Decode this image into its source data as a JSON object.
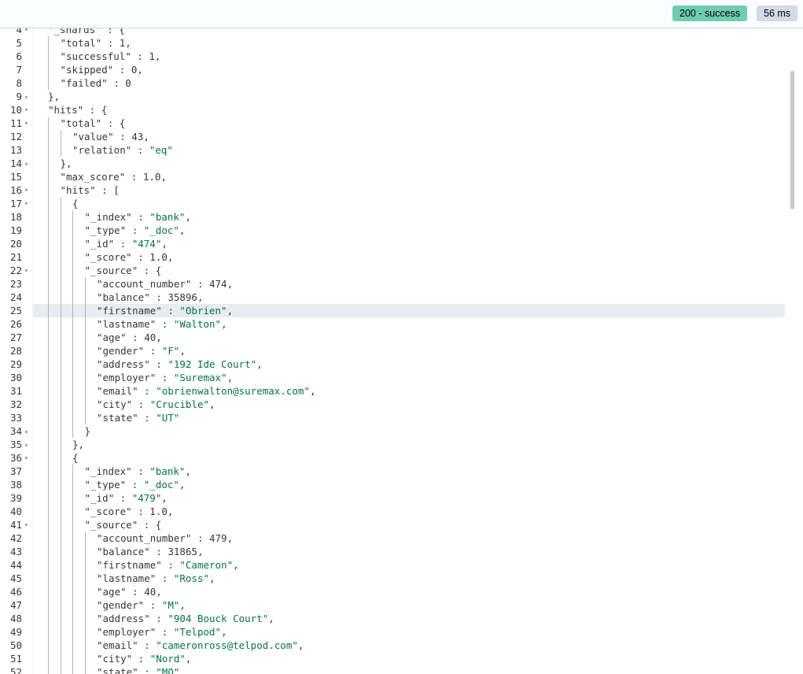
{
  "response": {
    "status_badge": "200 - success",
    "time_badge": "56 ms",
    "colors": {
      "success": "#6dccb1",
      "neutral": "#d3dae6",
      "string": "#00783e"
    }
  },
  "editor": {
    "active_line": 25,
    "lines": [
      {
        "n": "4",
        "fold": "down",
        "indent": 1,
        "text": "\"_shards\" : {"
      },
      {
        "n": "5",
        "fold": "",
        "indent": 2,
        "text": "\"total\" : 1,"
      },
      {
        "n": "6",
        "fold": "",
        "indent": 2,
        "text": "\"successful\" : 1,"
      },
      {
        "n": "7",
        "fold": "",
        "indent": 2,
        "text": "\"skipped\" : 0,"
      },
      {
        "n": "8",
        "fold": "",
        "indent": 2,
        "text": "\"failed\" : 0"
      },
      {
        "n": "9",
        "fold": "up",
        "indent": 1,
        "text": "},"
      },
      {
        "n": "10",
        "fold": "down",
        "indent": 1,
        "text": "\"hits\" : {"
      },
      {
        "n": "11",
        "fold": "down",
        "indent": 2,
        "text": "\"total\" : {"
      },
      {
        "n": "12",
        "fold": "",
        "indent": 3,
        "text": "\"value\" : 43,"
      },
      {
        "n": "13",
        "fold": "",
        "indent": 3,
        "text": "\"relation\" : \"eq\""
      },
      {
        "n": "14",
        "fold": "up",
        "indent": 2,
        "text": "},"
      },
      {
        "n": "15",
        "fold": "",
        "indent": 2,
        "text": "\"max_score\" : 1.0,"
      },
      {
        "n": "16",
        "fold": "down",
        "indent": 2,
        "text": "\"hits\" : ["
      },
      {
        "n": "17",
        "fold": "down",
        "indent": 3,
        "text": "{"
      },
      {
        "n": "18",
        "fold": "",
        "indent": 4,
        "text": "\"_index\" : \"bank\","
      },
      {
        "n": "19",
        "fold": "",
        "indent": 4,
        "text": "\"_type\" : \"_doc\","
      },
      {
        "n": "20",
        "fold": "",
        "indent": 4,
        "text": "\"_id\" : \"474\","
      },
      {
        "n": "21",
        "fold": "",
        "indent": 4,
        "text": "\"_score\" : 1.0,"
      },
      {
        "n": "22",
        "fold": "down",
        "indent": 4,
        "text": "\"_source\" : {"
      },
      {
        "n": "23",
        "fold": "",
        "indent": 5,
        "text": "\"account_number\" : 474,"
      },
      {
        "n": "24",
        "fold": "",
        "indent": 5,
        "text": "\"balance\" : 35896,"
      },
      {
        "n": "25",
        "fold": "",
        "indent": 5,
        "text": "\"firstname\" : \"Obrien\","
      },
      {
        "n": "26",
        "fold": "",
        "indent": 5,
        "text": "\"lastname\" : \"Walton\","
      },
      {
        "n": "27",
        "fold": "",
        "indent": 5,
        "text": "\"age\" : 40,"
      },
      {
        "n": "28",
        "fold": "",
        "indent": 5,
        "text": "\"gender\" : \"F\","
      },
      {
        "n": "29",
        "fold": "",
        "indent": 5,
        "text": "\"address\" : \"192 Ide Court\","
      },
      {
        "n": "30",
        "fold": "",
        "indent": 5,
        "text": "\"employer\" : \"Suremax\","
      },
      {
        "n": "31",
        "fold": "",
        "indent": 5,
        "text": "\"email\" : \"obrienwalton@suremax.com\","
      },
      {
        "n": "32",
        "fold": "",
        "indent": 5,
        "text": "\"city\" : \"Crucible\","
      },
      {
        "n": "33",
        "fold": "",
        "indent": 5,
        "text": "\"state\" : \"UT\""
      },
      {
        "n": "34",
        "fold": "up",
        "indent": 4,
        "text": "}"
      },
      {
        "n": "35",
        "fold": "up",
        "indent": 3,
        "text": "},"
      },
      {
        "n": "36",
        "fold": "down",
        "indent": 3,
        "text": "{"
      },
      {
        "n": "37",
        "fold": "",
        "indent": 4,
        "text": "\"_index\" : \"bank\","
      },
      {
        "n": "38",
        "fold": "",
        "indent": 4,
        "text": "\"_type\" : \"_doc\","
      },
      {
        "n": "39",
        "fold": "",
        "indent": 4,
        "text": "\"_id\" : \"479\","
      },
      {
        "n": "40",
        "fold": "",
        "indent": 4,
        "text": "\"_score\" : 1.0,"
      },
      {
        "n": "41",
        "fold": "down",
        "indent": 4,
        "text": "\"_source\" : {"
      },
      {
        "n": "42",
        "fold": "",
        "indent": 5,
        "text": "\"account_number\" : 479,"
      },
      {
        "n": "43",
        "fold": "",
        "indent": 5,
        "text": "\"balance\" : 31865,"
      },
      {
        "n": "44",
        "fold": "",
        "indent": 5,
        "text": "\"firstname\" : \"Cameron\","
      },
      {
        "n": "45",
        "fold": "",
        "indent": 5,
        "text": "\"lastname\" : \"Ross\","
      },
      {
        "n": "46",
        "fold": "",
        "indent": 5,
        "text": "\"age\" : 40,"
      },
      {
        "n": "47",
        "fold": "",
        "indent": 5,
        "text": "\"gender\" : \"M\","
      },
      {
        "n": "48",
        "fold": "",
        "indent": 5,
        "text": "\"address\" : \"904 Bouck Court\","
      },
      {
        "n": "49",
        "fold": "",
        "indent": 5,
        "text": "\"employer\" : \"Telpod\","
      },
      {
        "n": "50",
        "fold": "",
        "indent": 5,
        "text": "\"email\" : \"cameronross@telpod.com\","
      },
      {
        "n": "51",
        "fold": "",
        "indent": 5,
        "text": "\"city\" : \"Nord\","
      },
      {
        "n": "52",
        "fold": "",
        "indent": 5,
        "text": "\"state\" : \"MO\""
      }
    ]
  }
}
